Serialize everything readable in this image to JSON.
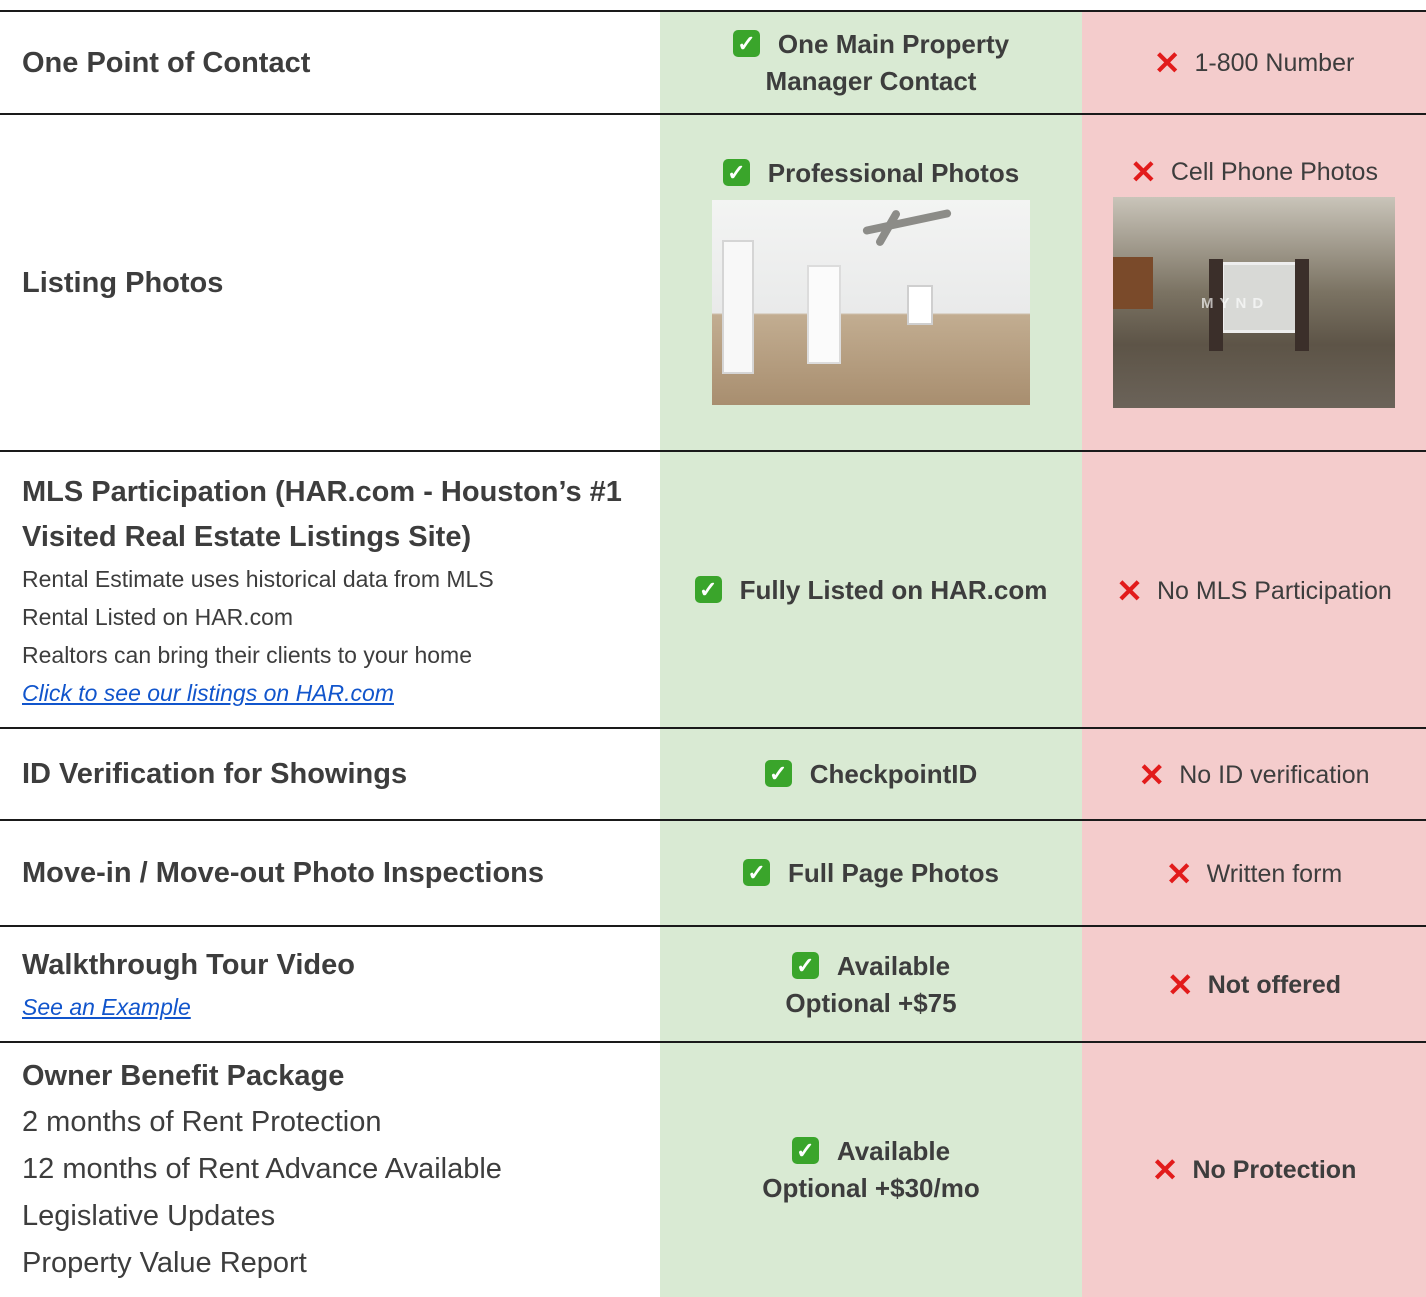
{
  "rows": [
    {
      "label": "One Point of Contact",
      "good": [
        "One Main Property",
        "Manager Contact"
      ],
      "bad": "1-800 Number"
    },
    {
      "label": "Listing Photos",
      "good": [
        "Professional Photos"
      ],
      "bad": "Cell Phone Photos",
      "bad_watermark": "MYND"
    },
    {
      "label": "MLS Participation (HAR.com - Houston’s #1 Visited Real Estate Listings Site)",
      "sub": [
        "Rental Estimate uses historical data from MLS",
        "Rental Listed on HAR.com",
        "Realtors can bring their clients to your home"
      ],
      "link": "Click to see our listings on HAR.com",
      "good": [
        "Fully Listed on HAR.com"
      ],
      "bad": "No MLS Participation"
    },
    {
      "label": "ID Verification for Showings",
      "good": [
        "CheckpointID"
      ],
      "bad": "No ID verification"
    },
    {
      "label": "Move-in / Move-out Photo Inspections",
      "good": [
        "Full Page Photos"
      ],
      "bad": "Written form"
    },
    {
      "label": "Walkthrough Tour Video",
      "link": "See an Example",
      "good": [
        "Available",
        "Optional +$75"
      ],
      "bad": "Not offered"
    },
    {
      "label": "Owner Benefit Package",
      "sub": [
        "2 months of Rent Protection",
        "12 months of Rent Advance Available",
        "Legislative Updates",
        "Property Value Report"
      ],
      "good": [
        "Available",
        "Optional +$30/mo"
      ],
      "bad": "No Protection"
    }
  ],
  "icons": {
    "good": "check-mark-icon",
    "bad": "cross-mark-icon"
  },
  "colors": {
    "good_bg": "#d9ead3",
    "bad_bg": "#f4cccc",
    "check": "#3aa52b",
    "cross": "#e21b1b",
    "link": "#1155cc"
  }
}
